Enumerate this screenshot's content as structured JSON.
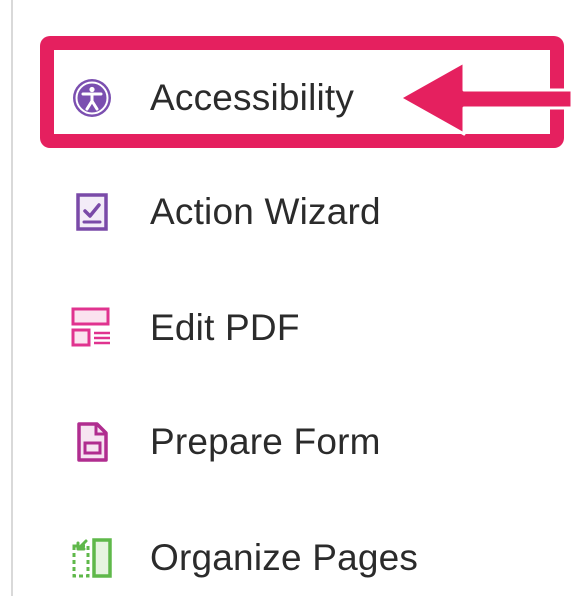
{
  "tools_panel": {
    "items": [
      {
        "label": "Accessibility",
        "icon": "accessibility-icon"
      },
      {
        "label": "Action Wizard",
        "icon": "action-wizard-icon"
      },
      {
        "label": "Edit PDF",
        "icon": "edit-pdf-icon"
      },
      {
        "label": "Prepare Form",
        "icon": "prepare-form-icon"
      },
      {
        "label": "Organize Pages",
        "icon": "organize-pages-icon"
      }
    ]
  },
  "annotation": {
    "highlight_color": "#e5205f",
    "target": "Accessibility"
  },
  "colors": {
    "accessibility_purple": "#7b4fb0",
    "action_wizard_purple": "#7a4aa8",
    "edit_pdf_magenta": "#e0338f",
    "prepare_form_magenta": "#b02d8f",
    "organize_pages_green": "#5fb84a"
  }
}
